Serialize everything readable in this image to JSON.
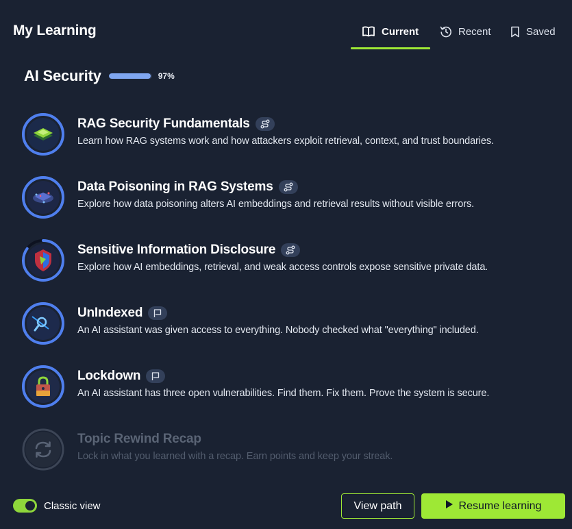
{
  "header": {
    "title": "My Learning",
    "tabs": [
      {
        "label": "Current",
        "icon": "book-open-icon",
        "active": true
      },
      {
        "label": "Recent",
        "icon": "history-icon",
        "active": false
      },
      {
        "label": "Saved",
        "icon": "bookmark-icon",
        "active": false
      }
    ]
  },
  "path": {
    "title": "AI Security",
    "progress_percent": 97,
    "progress_label": "97%"
  },
  "modules": [
    {
      "name": "RAG Security Fundamentals",
      "badge_icon": "route-icon",
      "description": "Learn how RAG systems work and how attackers exploit retrieval, context, and trust boundaries.",
      "progress": 1.0,
      "locked": false
    },
    {
      "name": "Data Poisoning in RAG Systems",
      "badge_icon": "route-icon",
      "description": "Explore how data poisoning alters AI embeddings and retrieval results without visible errors.",
      "progress": 1.0,
      "locked": false
    },
    {
      "name": "Sensitive Information Disclosure",
      "badge_icon": "route-icon",
      "description": "Explore how AI embeddings, retrieval, and weak access controls expose sensitive private data.",
      "progress": 0.85,
      "locked": false
    },
    {
      "name": "UnIndexed",
      "badge_icon": "flag-icon",
      "description": "An AI assistant was given access to everything. Nobody checked what \"everything\" included.",
      "progress": 1.0,
      "locked": false
    },
    {
      "name": "Lockdown",
      "badge_icon": "flag-icon",
      "description": "An AI assistant has three open vulnerabilities. Find them. Fix them. Prove the system is secure.",
      "progress": 1.0,
      "locked": false
    },
    {
      "name": "Topic Rewind Recap",
      "badge_icon": "",
      "description": "Lock in what you learned with a recap. Earn points and keep your streak.",
      "progress": 0,
      "locked": true
    }
  ],
  "footer": {
    "toggle_label": "Classic view",
    "toggle_on": true,
    "view_path_label": "View path",
    "resume_label": "Resume learning"
  },
  "colors": {
    "background": "#1a2232",
    "accent": "#9ee835",
    "ring": "#4f7fee",
    "progress": "#7fa6f0"
  }
}
